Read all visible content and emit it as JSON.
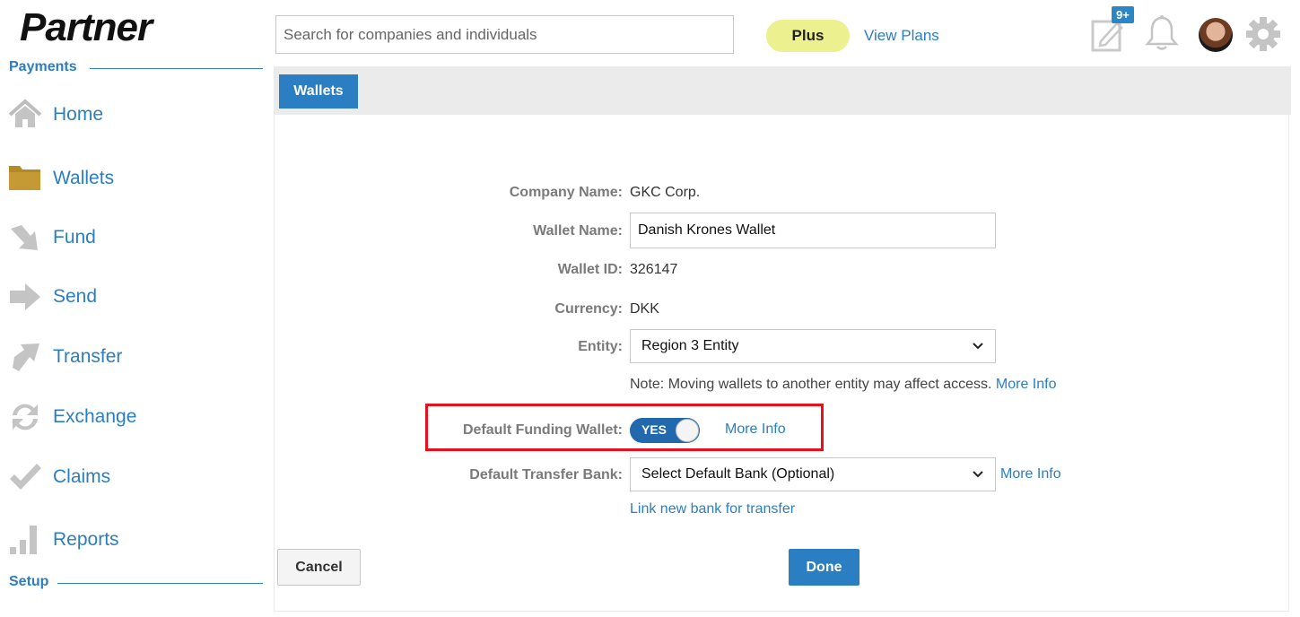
{
  "brand": {
    "logo_text": "Partner"
  },
  "header": {
    "search_placeholder": "Search for companies and individuals",
    "plus_label": "Plus",
    "view_plans_label": "View Plans",
    "notification_badge": "9+"
  },
  "sidebar": {
    "payments_heading": "Payments",
    "setup_heading": "Setup",
    "items": [
      {
        "label": "Home",
        "icon": "home-icon"
      },
      {
        "label": "Wallets",
        "icon": "folder-icon"
      },
      {
        "label": "Fund",
        "icon": "fund-arrow-icon"
      },
      {
        "label": "Send",
        "icon": "send-arrow-icon"
      },
      {
        "label": "Transfer",
        "icon": "transfer-arrow-icon"
      },
      {
        "label": "Exchange",
        "icon": "exchange-icon"
      },
      {
        "label": "Claims",
        "icon": "checkmark-icon"
      },
      {
        "label": "Reports",
        "icon": "bar-chart-icon"
      }
    ]
  },
  "tabs": {
    "active": "Wallets"
  },
  "form": {
    "company_name_label": "Company Name:",
    "company_name_value": "GKC Corp.",
    "wallet_name_label": "Wallet Name:",
    "wallet_name_value": "Danish Krones Wallet",
    "wallet_id_label": "Wallet ID:",
    "wallet_id_value": "326147",
    "currency_label": "Currency:",
    "currency_value": "DKK",
    "entity_label": "Entity:",
    "entity_value": "Region 3 Entity",
    "entity_note": "Note: Moving wallets to another entity may affect access.",
    "more_info": "More Info",
    "default_funding_label": "Default Funding Wallet:",
    "default_funding_toggle": "YES",
    "default_transfer_bank_label": "Default Transfer Bank:",
    "default_transfer_bank_value": "Select Default Bank (Optional)",
    "link_new_bank": "Link new bank for transfer"
  },
  "actions": {
    "cancel": "Cancel",
    "done": "Done"
  },
  "colors": {
    "accent": "#2b7ec1",
    "highlight": "#e8101c",
    "plus_bg": "#ecf08e",
    "toggle": "#2268ad"
  }
}
